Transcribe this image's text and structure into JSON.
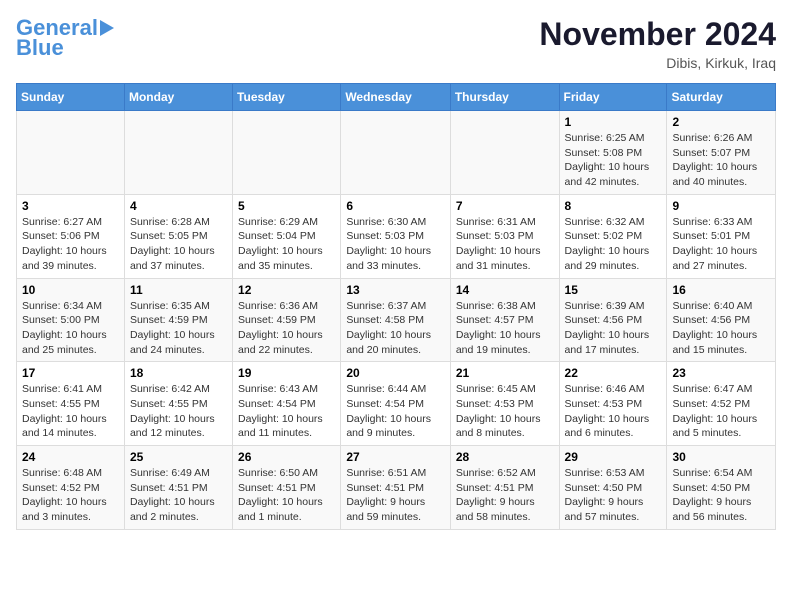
{
  "header": {
    "logo_line1": "General",
    "logo_line2": "Blue",
    "month": "November 2024",
    "location": "Dibis, Kirkuk, Iraq"
  },
  "days_of_week": [
    "Sunday",
    "Monday",
    "Tuesday",
    "Wednesday",
    "Thursday",
    "Friday",
    "Saturday"
  ],
  "weeks": [
    [
      {
        "day": "",
        "info": ""
      },
      {
        "day": "",
        "info": ""
      },
      {
        "day": "",
        "info": ""
      },
      {
        "day": "",
        "info": ""
      },
      {
        "day": "",
        "info": ""
      },
      {
        "day": "1",
        "info": "Sunrise: 6:25 AM\nSunset: 5:08 PM\nDaylight: 10 hours and 42 minutes."
      },
      {
        "day": "2",
        "info": "Sunrise: 6:26 AM\nSunset: 5:07 PM\nDaylight: 10 hours and 40 minutes."
      }
    ],
    [
      {
        "day": "3",
        "info": "Sunrise: 6:27 AM\nSunset: 5:06 PM\nDaylight: 10 hours and 39 minutes."
      },
      {
        "day": "4",
        "info": "Sunrise: 6:28 AM\nSunset: 5:05 PM\nDaylight: 10 hours and 37 minutes."
      },
      {
        "day": "5",
        "info": "Sunrise: 6:29 AM\nSunset: 5:04 PM\nDaylight: 10 hours and 35 minutes."
      },
      {
        "day": "6",
        "info": "Sunrise: 6:30 AM\nSunset: 5:03 PM\nDaylight: 10 hours and 33 minutes."
      },
      {
        "day": "7",
        "info": "Sunrise: 6:31 AM\nSunset: 5:03 PM\nDaylight: 10 hours and 31 minutes."
      },
      {
        "day": "8",
        "info": "Sunrise: 6:32 AM\nSunset: 5:02 PM\nDaylight: 10 hours and 29 minutes."
      },
      {
        "day": "9",
        "info": "Sunrise: 6:33 AM\nSunset: 5:01 PM\nDaylight: 10 hours and 27 minutes."
      }
    ],
    [
      {
        "day": "10",
        "info": "Sunrise: 6:34 AM\nSunset: 5:00 PM\nDaylight: 10 hours and 25 minutes."
      },
      {
        "day": "11",
        "info": "Sunrise: 6:35 AM\nSunset: 4:59 PM\nDaylight: 10 hours and 24 minutes."
      },
      {
        "day": "12",
        "info": "Sunrise: 6:36 AM\nSunset: 4:59 PM\nDaylight: 10 hours and 22 minutes."
      },
      {
        "day": "13",
        "info": "Sunrise: 6:37 AM\nSunset: 4:58 PM\nDaylight: 10 hours and 20 minutes."
      },
      {
        "day": "14",
        "info": "Sunrise: 6:38 AM\nSunset: 4:57 PM\nDaylight: 10 hours and 19 minutes."
      },
      {
        "day": "15",
        "info": "Sunrise: 6:39 AM\nSunset: 4:56 PM\nDaylight: 10 hours and 17 minutes."
      },
      {
        "day": "16",
        "info": "Sunrise: 6:40 AM\nSunset: 4:56 PM\nDaylight: 10 hours and 15 minutes."
      }
    ],
    [
      {
        "day": "17",
        "info": "Sunrise: 6:41 AM\nSunset: 4:55 PM\nDaylight: 10 hours and 14 minutes."
      },
      {
        "day": "18",
        "info": "Sunrise: 6:42 AM\nSunset: 4:55 PM\nDaylight: 10 hours and 12 minutes."
      },
      {
        "day": "19",
        "info": "Sunrise: 6:43 AM\nSunset: 4:54 PM\nDaylight: 10 hours and 11 minutes."
      },
      {
        "day": "20",
        "info": "Sunrise: 6:44 AM\nSunset: 4:54 PM\nDaylight: 10 hours and 9 minutes."
      },
      {
        "day": "21",
        "info": "Sunrise: 6:45 AM\nSunset: 4:53 PM\nDaylight: 10 hours and 8 minutes."
      },
      {
        "day": "22",
        "info": "Sunrise: 6:46 AM\nSunset: 4:53 PM\nDaylight: 10 hours and 6 minutes."
      },
      {
        "day": "23",
        "info": "Sunrise: 6:47 AM\nSunset: 4:52 PM\nDaylight: 10 hours and 5 minutes."
      }
    ],
    [
      {
        "day": "24",
        "info": "Sunrise: 6:48 AM\nSunset: 4:52 PM\nDaylight: 10 hours and 3 minutes."
      },
      {
        "day": "25",
        "info": "Sunrise: 6:49 AM\nSunset: 4:51 PM\nDaylight: 10 hours and 2 minutes."
      },
      {
        "day": "26",
        "info": "Sunrise: 6:50 AM\nSunset: 4:51 PM\nDaylight: 10 hours and 1 minute."
      },
      {
        "day": "27",
        "info": "Sunrise: 6:51 AM\nSunset: 4:51 PM\nDaylight: 9 hours and 59 minutes."
      },
      {
        "day": "28",
        "info": "Sunrise: 6:52 AM\nSunset: 4:51 PM\nDaylight: 9 hours and 58 minutes."
      },
      {
        "day": "29",
        "info": "Sunrise: 6:53 AM\nSunset: 4:50 PM\nDaylight: 9 hours and 57 minutes."
      },
      {
        "day": "30",
        "info": "Sunrise: 6:54 AM\nSunset: 4:50 PM\nDaylight: 9 hours and 56 minutes."
      }
    ]
  ]
}
